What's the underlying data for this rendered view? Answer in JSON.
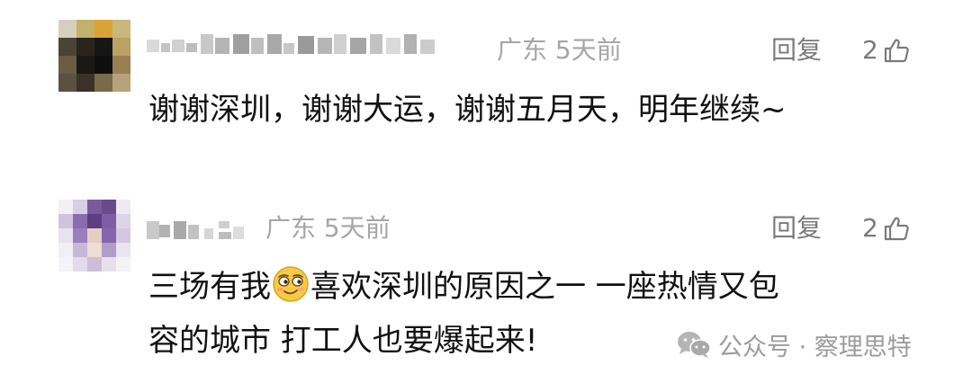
{
  "comments": [
    {
      "avatar": "pixelated-avatar",
      "username": "",
      "region_time": "广东  5天前",
      "reply_label": "回复",
      "likes": "2",
      "text_lines": [
        "谢谢深圳，谢谢大运，谢谢五月天，明年继续~"
      ]
    },
    {
      "avatar": "pixelated-avatar",
      "username": "",
      "region_time": "广东  5天前",
      "reply_label": "回复",
      "likes": "2",
      "text_before_emoji": "三场有我",
      "emoji": "smirk-face-emoji",
      "text_after_emoji": "喜欢深圳的原因之一 一座热情又包",
      "text_line2": "容的城市 打工人也要爆起来!"
    }
  ],
  "watermark": {
    "icon": "wechat-icon",
    "text": "公众号 · 察理思特"
  },
  "icons": {
    "like": "thumbs-up-icon"
  },
  "colors": {
    "meta_text": "#a6a6a6",
    "action_text": "#7a7a7a",
    "body_text": "#111111",
    "emoji_face": "#f7c948"
  }
}
